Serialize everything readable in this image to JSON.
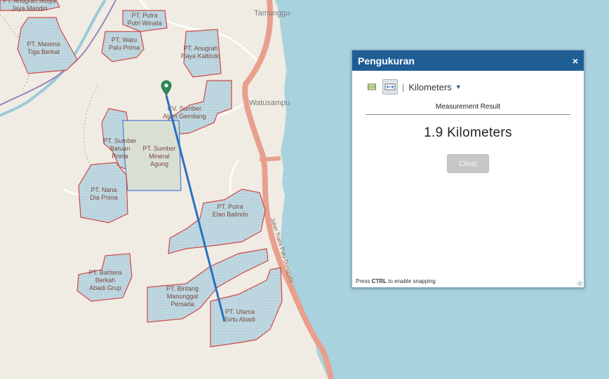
{
  "map": {
    "place_labels": [
      "Tamunggu",
      "Watusampu"
    ],
    "road_label": "Jalan Trans Palu-Donggala",
    "concessions": [
      [
        "PT. Anugrah Mulya",
        "Jaya Mandiri"
      ],
      [
        "PT. Maxima",
        "Tiga Berkat"
      ],
      [
        "PT. Putra",
        "Putri Winata"
      ],
      [
        "PT. Watu",
        "Palu Prima"
      ],
      [
        "PT. Anugrah",
        "Raya Kaltindo"
      ],
      [
        "CV. Sumber",
        "Alam Gemilang"
      ],
      [
        "PT. Sumber",
        "Batuan",
        "Prima"
      ],
      [
        "PT. Sumber",
        "Mineral",
        "Agung"
      ],
      [
        "PT. Nana",
        "Dia Prima"
      ],
      [
        "PT. Putra",
        "Elan Balindo"
      ],
      [
        "PT. Bahtera",
        "Berkah",
        "Abadi Grup"
      ],
      [
        "PT. Bintang",
        "Manunggal",
        "Persada"
      ],
      [
        "PT. Utama",
        "Sirtu Abadi"
      ]
    ],
    "colors": {
      "water": "#a8d2de",
      "land": "#f0ece4",
      "concession_fill": "#c3dbe3",
      "concession_border": "#d04848",
      "measure_line": "#2a6fc4",
      "marker": "#2e8b57",
      "highway": "#e8a08d"
    }
  },
  "panel": {
    "title": "Pengukuran",
    "close_icon": "×",
    "unit": "Kilometers",
    "result_label": "Measurement Result",
    "result_value": "1.9 Kilometers",
    "clear_label": "Clear",
    "hint_prefix": "Press ",
    "hint_key": "CTRL",
    "hint_suffix": " to enable snapping"
  }
}
